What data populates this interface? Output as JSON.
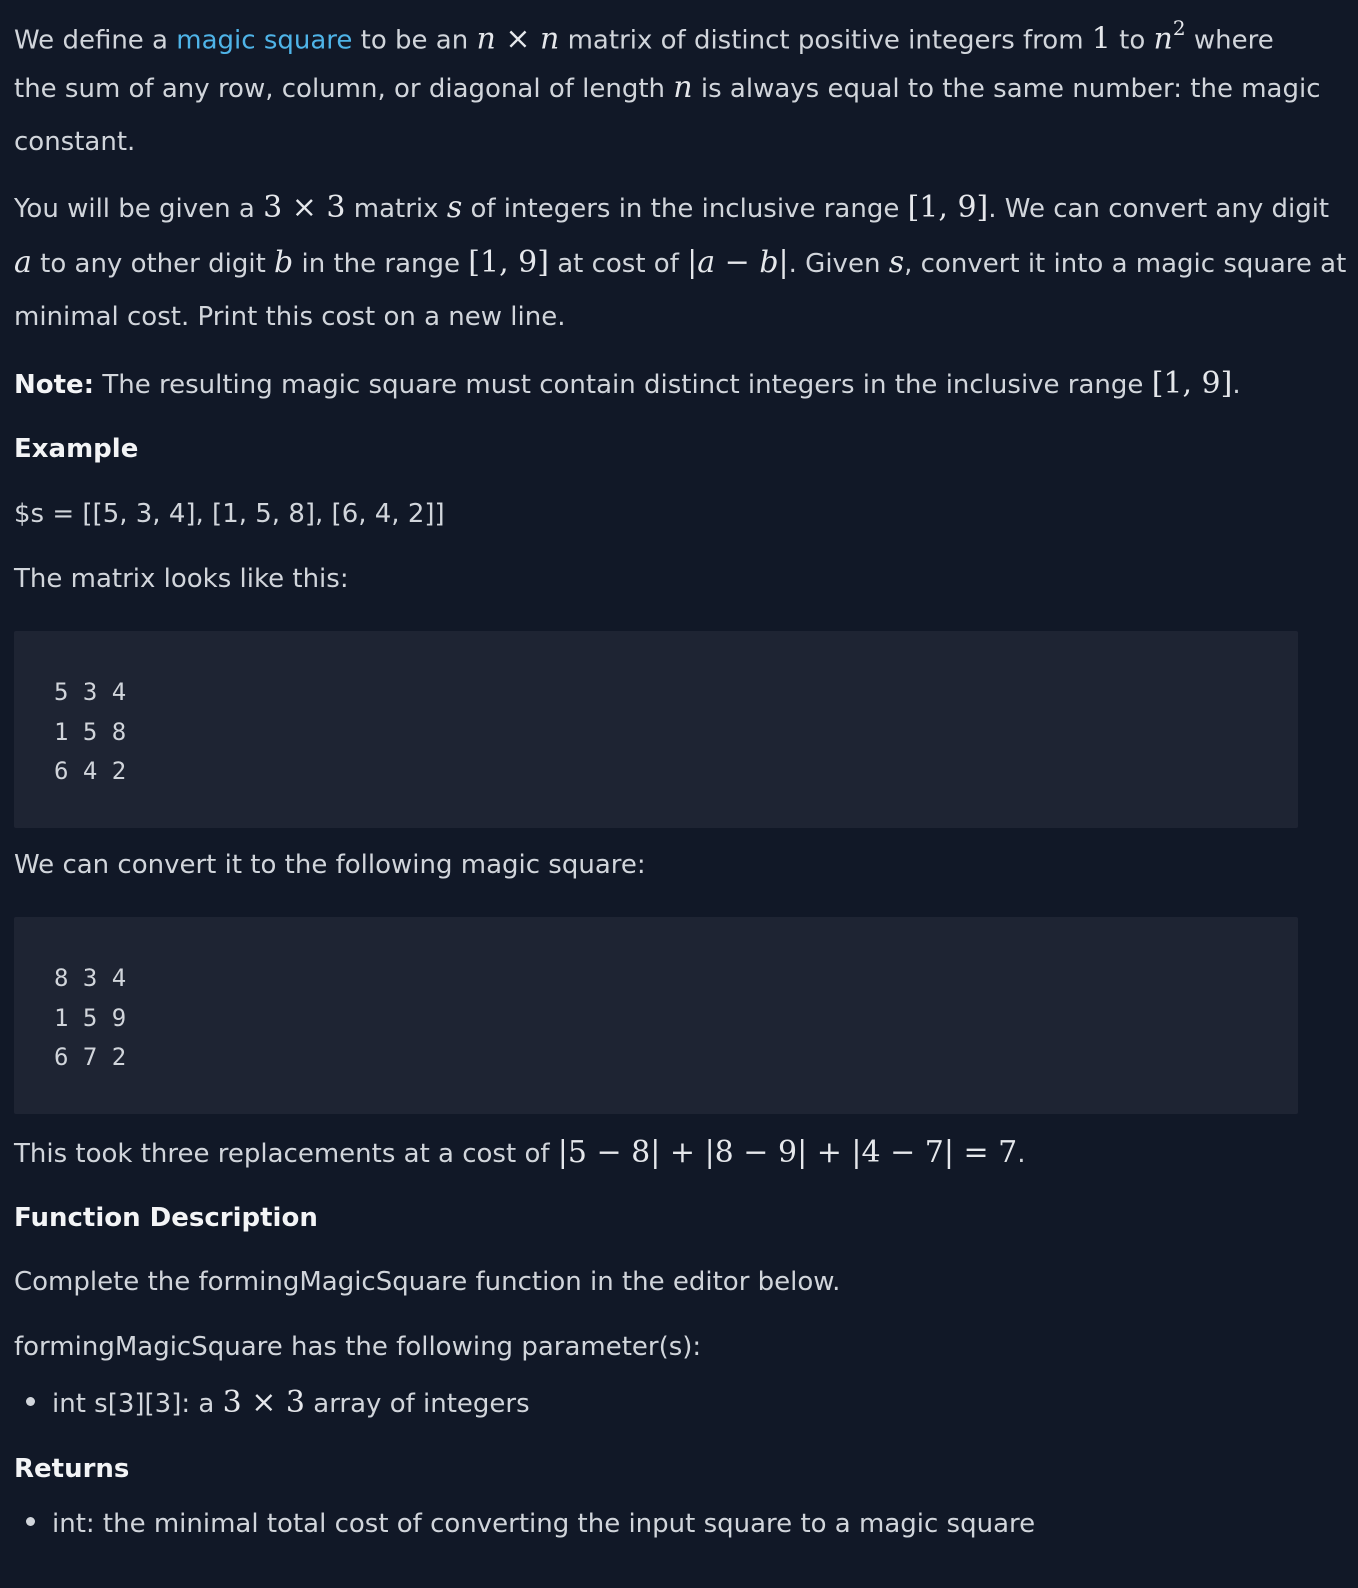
{
  "intro": {
    "t1": "We define a ",
    "link": "magic square",
    "t2": " to be an ",
    "t3": " matrix of distinct positive integers from ",
    "t4": " to ",
    "t5": " where",
    "line2": "the sum of any row, column, or diagonal of length ",
    "line2b": " is always equal to the same number: the magic",
    "line3": "constant."
  },
  "given": {
    "t1": "You will be given a ",
    "t2": " matrix ",
    "t3": " of integers in the inclusive range ",
    "t4": ". We can convert any digit",
    "t5": " to any other digit ",
    "t6": " in the range ",
    "t7": " at cost of ",
    "t8": ". Given ",
    "t9": ", convert it into a magic square at",
    "line3": "minimal cost. Print this cost on a new line."
  },
  "note": {
    "label": "Note:",
    "text": " The resulting magic square must contain distinct integers in the inclusive range ",
    "end": "."
  },
  "example_heading": "Example",
  "example_s": "$s = [[5, 3, 4], [1, 5, 8], [6, 4, 2]]",
  "matrix_intro": "The matrix looks like this:",
  "matrix_code": "5 3 4\n1 5 8\n6 4 2",
  "convert_intro": "We can convert it to the following magic square:",
  "magic_code": "8 3 4\n1 5 9\n6 7 2",
  "took": {
    "text": "This took three replacements at a cost of ",
    "end": "."
  },
  "function_heading": "Function Description",
  "complete_text": "Complete the formingMagicSquare function in the editor below.",
  "params_text": "formingMagicSquare has the following parameter(s):",
  "param_item": {
    "t1": "int s[3][3]: a ",
    "t2": " array of integers"
  },
  "returns_heading": "Returns",
  "returns_item": "int: the minimal total cost of converting the input square to a magic square",
  "math": {
    "n": "n",
    "times": " × ",
    "one": "1",
    "n2_base": "n",
    "n2_exp": "2",
    "three": "3",
    "s": "s",
    "range": "[1, 9]",
    "a": "a",
    "b": "b",
    "abs_ab": "|a − b|",
    "cost_expr": "|5 − 8| + |8 − 9| + |4 − 7| = 7"
  }
}
